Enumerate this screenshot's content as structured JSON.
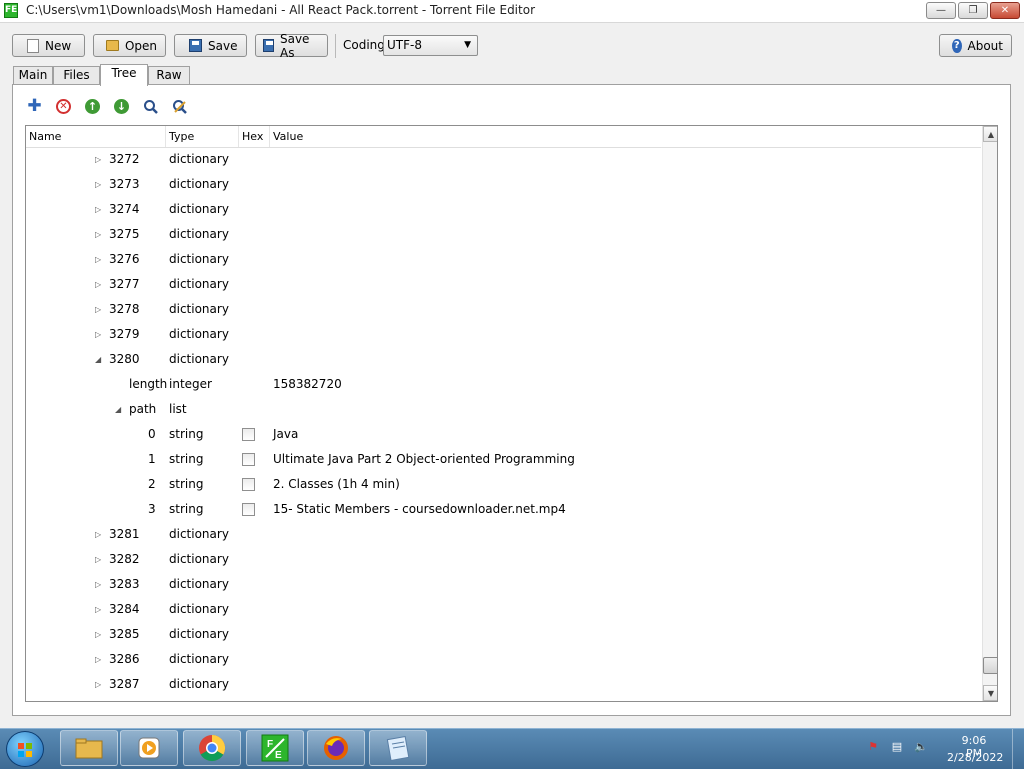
{
  "window": {
    "title": "C:\\Users\\vm1\\Downloads\\Mosh Hamedani - All React Pack.torrent - Torrent File Editor",
    "app_icon_label": "FE"
  },
  "toolbar": {
    "new_label": "New",
    "open_label": "Open",
    "save_label": "Save",
    "save_as_label": "Save As",
    "coding_label": "Coding",
    "coding_value": "UTF-8",
    "about_label": "About"
  },
  "tabs": [
    {
      "label": "Main"
    },
    {
      "label": "Files"
    },
    {
      "label": "Tree"
    },
    {
      "label": "Raw"
    }
  ],
  "tree": {
    "columns": {
      "name": "Name",
      "type": "Type",
      "hex": "Hex",
      "value": "Value"
    },
    "rows": [
      {
        "name": "3272",
        "type": "dictionary",
        "value": "",
        "level": 0,
        "expander": "collapsed",
        "hex": false
      },
      {
        "name": "3273",
        "type": "dictionary",
        "value": "",
        "level": 0,
        "expander": "collapsed",
        "hex": false
      },
      {
        "name": "3274",
        "type": "dictionary",
        "value": "",
        "level": 0,
        "expander": "collapsed",
        "hex": false
      },
      {
        "name": "3275",
        "type": "dictionary",
        "value": "",
        "level": 0,
        "expander": "collapsed",
        "hex": false
      },
      {
        "name": "3276",
        "type": "dictionary",
        "value": "",
        "level": 0,
        "expander": "collapsed",
        "hex": false
      },
      {
        "name": "3277",
        "type": "dictionary",
        "value": "",
        "level": 0,
        "expander": "collapsed",
        "hex": false
      },
      {
        "name": "3278",
        "type": "dictionary",
        "value": "",
        "level": 0,
        "expander": "collapsed",
        "hex": false
      },
      {
        "name": "3279",
        "type": "dictionary",
        "value": "",
        "level": 0,
        "expander": "collapsed",
        "hex": false
      },
      {
        "name": "3280",
        "type": "dictionary",
        "value": "",
        "level": 0,
        "expander": "expanded",
        "hex": false
      },
      {
        "name": "length",
        "type": "integer",
        "value": "158382720",
        "level": 1,
        "expander": "none",
        "hex": false
      },
      {
        "name": "path",
        "type": "list",
        "value": "",
        "level": 1,
        "expander": "expanded",
        "hex": false
      },
      {
        "name": "0",
        "type": "string",
        "value": "Java",
        "level": 2,
        "expander": "none",
        "hex": true
      },
      {
        "name": "1",
        "type": "string",
        "value": "Ultimate Java Part 2 Object-oriented Programming",
        "level": 2,
        "expander": "none",
        "hex": true
      },
      {
        "name": "2",
        "type": "string",
        "value": "2. Classes (1h 4 min)",
        "level": 2,
        "expander": "none",
        "hex": true
      },
      {
        "name": "3",
        "type": "string",
        "value": "15- Static Members - coursedownloader.net.mp4",
        "level": 2,
        "expander": "none",
        "hex": true
      },
      {
        "name": "3281",
        "type": "dictionary",
        "value": "",
        "level": 0,
        "expander": "collapsed",
        "hex": false
      },
      {
        "name": "3282",
        "type": "dictionary",
        "value": "",
        "level": 0,
        "expander": "collapsed",
        "hex": false
      },
      {
        "name": "3283",
        "type": "dictionary",
        "value": "",
        "level": 0,
        "expander": "collapsed",
        "hex": false
      },
      {
        "name": "3284",
        "type": "dictionary",
        "value": "",
        "level": 0,
        "expander": "collapsed",
        "hex": false
      },
      {
        "name": "3285",
        "type": "dictionary",
        "value": "",
        "level": 0,
        "expander": "collapsed",
        "hex": false
      },
      {
        "name": "3286",
        "type": "dictionary",
        "value": "",
        "level": 0,
        "expander": "collapsed",
        "hex": false
      },
      {
        "name": "3287",
        "type": "dictionary",
        "value": "",
        "level": 0,
        "expander": "collapsed",
        "hex": false
      }
    ],
    "scroll_position": 0.98
  },
  "panel_tools": [
    {
      "icon": "add-icon",
      "glyph": "+",
      "color": "#2f66b8"
    },
    {
      "icon": "remove-icon",
      "glyph": "×",
      "color": "#d23030"
    },
    {
      "icon": "move-up-icon",
      "glyph": "↑",
      "color": "#3f9a35"
    },
    {
      "icon": "move-down-icon",
      "glyph": "↓",
      "color": "#3f9a35"
    },
    {
      "icon": "find-icon",
      "glyph": "",
      "color": "#2a4f8a"
    },
    {
      "icon": "find-replace-icon",
      "glyph": "",
      "color": "#2a4f8a"
    }
  ],
  "taskbar": {
    "time": "9:06 PM",
    "date": "2/28/2022",
    "apps": [
      {
        "name": "file-explorer",
        "icon": "folder-icon"
      },
      {
        "name": "media-player",
        "icon": "media-player-icon"
      },
      {
        "name": "chrome",
        "icon": "chrome-icon"
      },
      {
        "name": "torrent-file-editor",
        "icon": "torrent-editor-icon",
        "label": "FE"
      },
      {
        "name": "firefox",
        "icon": "firefox-icon"
      },
      {
        "name": "notepad",
        "icon": "notepad-icon"
      }
    ]
  }
}
